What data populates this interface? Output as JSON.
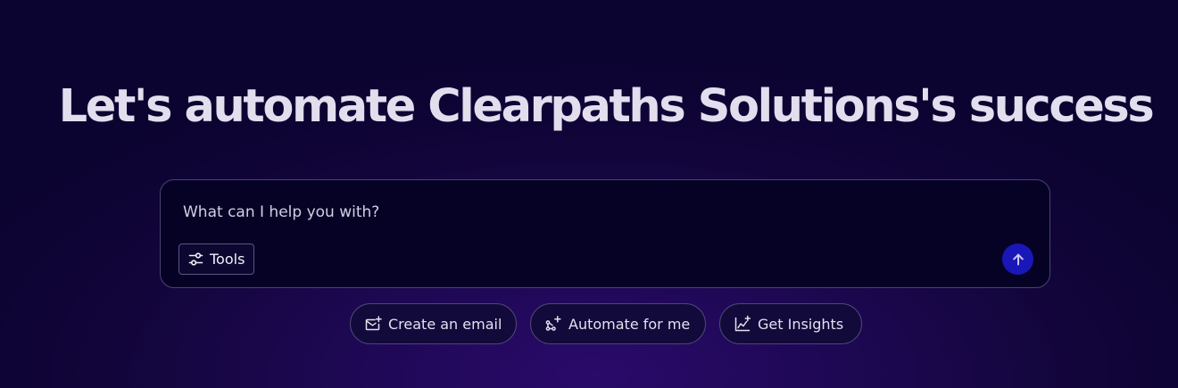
{
  "headline": "Let's automate Clearpaths Solutions's success",
  "prompt": {
    "placeholder": "What can I help you with?",
    "value": "",
    "tools_label": "Tools",
    "send_icon": "arrow-up-icon",
    "tools_icon": "sliders-icon"
  },
  "suggestions": [
    {
      "label": "Create an email",
      "icon": "mail-plus-icon"
    },
    {
      "label": "Automate for me",
      "icon": "workflow-sparkle-icon"
    },
    {
      "label": "Get Insights",
      "icon": "chart-sparkle-icon"
    }
  ],
  "colors": {
    "background": "#0b0330",
    "background_glow": "#2a0a6a",
    "prompt_background": "#060226",
    "send_button": "#1a17b8",
    "text": "#e2deee"
  }
}
